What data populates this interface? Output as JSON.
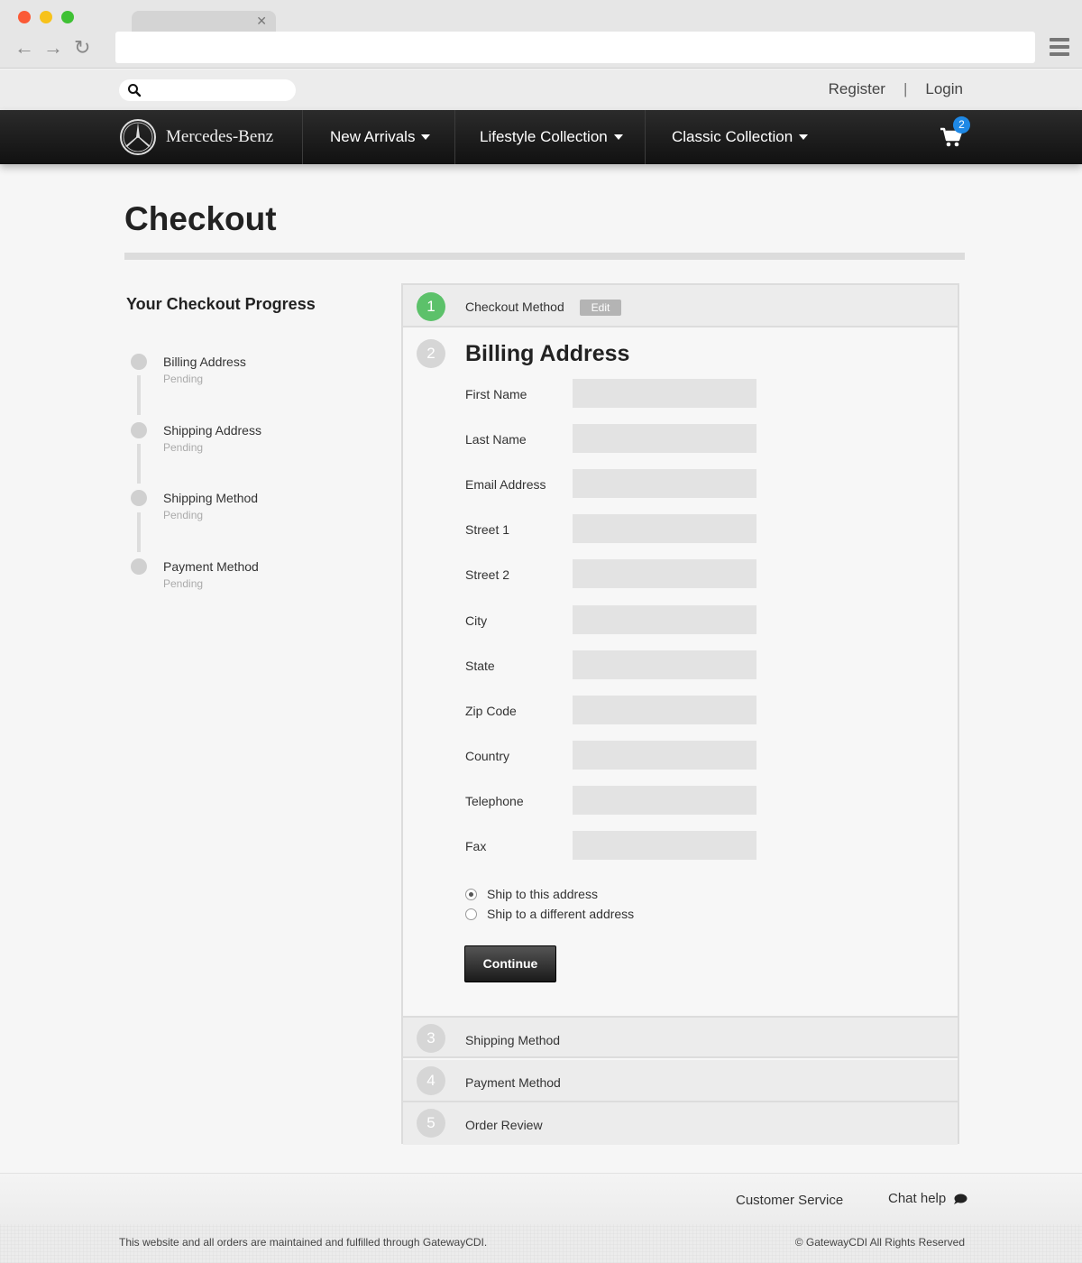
{
  "utility": {
    "register": "Register",
    "separator": "|",
    "login": "Login"
  },
  "nav": {
    "logo_text": "Mercedes-Benz",
    "items": [
      "New Arrivals",
      "Lifestyle Collection",
      "Classic Collection"
    ],
    "cart_count": "2"
  },
  "page": {
    "title": "Checkout"
  },
  "progress": {
    "title": "Your Checkout Progress",
    "steps": [
      {
        "label": "Billing Address",
        "status": "Pending"
      },
      {
        "label": "Shipping Address",
        "status": "Pending"
      },
      {
        "label": "Shipping Method",
        "status": "Pending"
      },
      {
        "label": "Payment Method",
        "status": "Pending"
      }
    ]
  },
  "checkout": {
    "step1": {
      "number": "1",
      "title": "Checkout Method",
      "edit": "Edit"
    },
    "billing": {
      "number": "2",
      "title": "Billing Address",
      "fields": [
        "First Name",
        "Last Name",
        "Email Address",
        "Street 1",
        "Street 2",
        "City",
        "State",
        "Zip Code",
        "Country",
        "Telephone",
        "Fax"
      ],
      "options": [
        "Ship to this address",
        "Ship to a different address"
      ],
      "continue": "Continue"
    },
    "step3": {
      "number": "3",
      "title": "Shipping Method"
    },
    "step4": {
      "number": "4",
      "title": "Payment Method"
    },
    "step5": {
      "number": "5",
      "title": "Order Review"
    }
  },
  "footer": {
    "customer_service": "Customer Service",
    "chat_help": "Chat help",
    "disclaimer": "This website and all orders are maintained and fulfilled through GatewayCDI.",
    "copyright": "© GatewayCDI All Rights Reserved"
  },
  "colors": {
    "accent_green": "#5cc16a",
    "badge_blue": "#1e88e5",
    "nav_dark": "#1a1a1a"
  }
}
